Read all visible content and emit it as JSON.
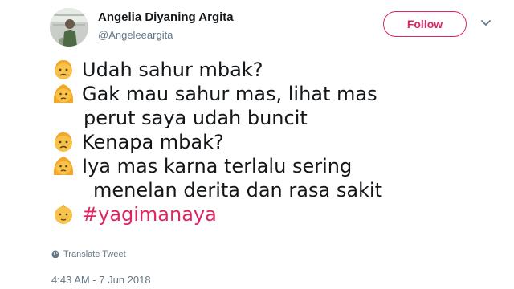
{
  "user": {
    "display_name": "Angelia Diyaning Argita",
    "handle": "@Angeleeargita",
    "avatar_icon": "profile-photo"
  },
  "actions": {
    "follow_label": "Follow",
    "menu_icon": "chevron-down-icon",
    "accent_color": "#e0245e"
  },
  "tweet": {
    "lines": [
      {
        "emoji": "man-frowning",
        "text": "Udah sahur mbak?"
      },
      {
        "emoji": "woman-frowning",
        "text": "Gak mau sahur mas, lihat mas"
      },
      {
        "emoji": "",
        "text": "perut saya udah buncit"
      },
      {
        "emoji": "man-frowning",
        "text": "Kenapa mbak?"
      },
      {
        "emoji": "woman-frowning",
        "text": "Iya mas karna terlalu sering"
      },
      {
        "emoji": "",
        "text": "menelan derita dan rasa sakit"
      },
      {
        "emoji": "baby-face",
        "text": "#yagimanaya"
      }
    ]
  },
  "footer": {
    "translate_label": "Translate Tweet",
    "timestamp": "4:43 AM - 7 Jun 2018"
  }
}
